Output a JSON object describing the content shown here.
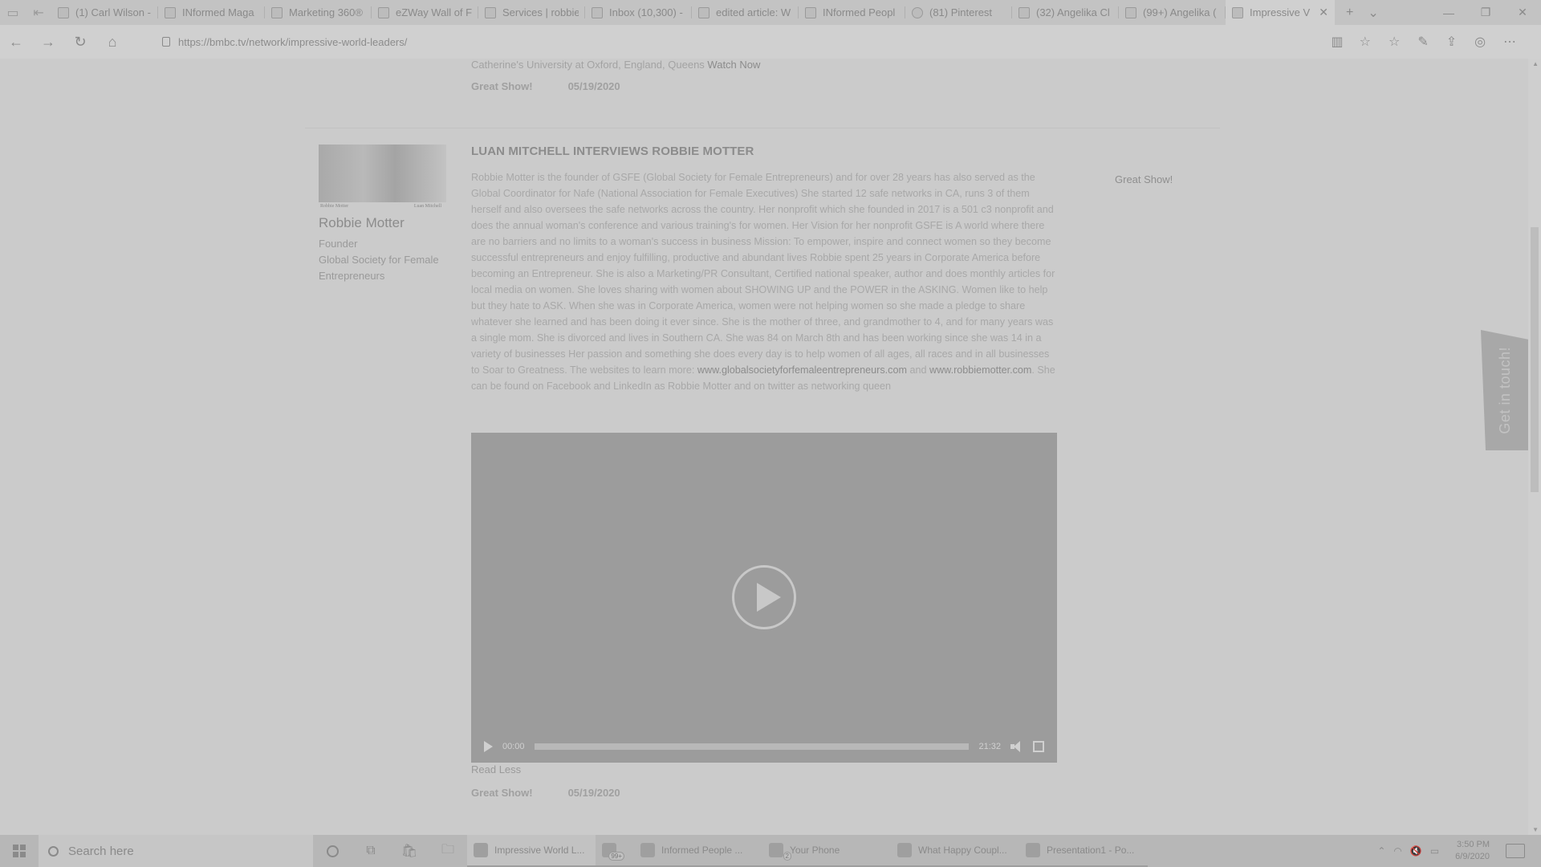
{
  "browser": {
    "tabs": [
      {
        "label": "(1) Carl Wilson -",
        "icon": "facebook-icon"
      },
      {
        "label": "INformed Maga",
        "icon": "page-icon"
      },
      {
        "label": "Marketing 360®",
        "icon": "page-icon"
      },
      {
        "label": "eZWay Wall of F",
        "icon": "page-icon"
      },
      {
        "label": "Services | robbie",
        "icon": "page-icon"
      },
      {
        "label": "Inbox (10,300) -",
        "icon": "mail-icon"
      },
      {
        "label": "edited article: W",
        "icon": "mail-icon"
      },
      {
        "label": "INformed Peopl",
        "icon": "page-icon"
      },
      {
        "label": "(81) Pinterest",
        "icon": "pinterest-icon"
      },
      {
        "label": "(32) Angelika Cl",
        "icon": "page-icon"
      },
      {
        "label": "(99+) Angelika (",
        "icon": "page-icon"
      },
      {
        "label": "Impressive V",
        "icon": "page-icon",
        "active": true
      }
    ],
    "url": "https://bmbc.tv/network/impressive-world-leaders/"
  },
  "prev_entry": {
    "tail_text": "Catherine's University at Oxford, England, Queens",
    "watch_label": "Watch Now",
    "rating": "Great Show!",
    "date": "05/19/2020"
  },
  "entry": {
    "title": "LUAN MITCHELL INTERVIEWS ROBBIE MOTTER",
    "photo_caption_left": "Robbie Motter",
    "photo_caption_right": "Luan Mitchell",
    "person_name": "Robbie Motter",
    "person_role": "Founder",
    "person_org": "Global Society for Female Entrepreneurs",
    "body_text": "Robbie Motter is the founder of GSFE (Global Society for Female Entrepreneurs) and for over 28 years has also served as the Global Coordinator for Nafe (National Association for Female Executives) She started 12 safe networks in CA, runs 3 of them herself and also oversees the safe networks across the country. Her nonprofit which she founded in 2017 is a 501 c3 nonprofit and does the annual woman's conference and various training's for women. Her Vision for her nonprofit GSFE is A world where there are no barriers and no limits to a woman's success in business Mission: To empower, inspire and connect women so they become successful entrepreneurs and enjoy fulfilling, productive and abundant lives Robbie spent 25 years in Corporate America before becoming an Entrepreneur. She is also a Marketing/PR Consultant, Certified national speaker, author and does monthly articles for local media on women. She loves sharing with women about SHOWING UP and the POWER in the ASKING. Women like to help but they hate to ASK. When she was in Corporate America, women were not helping women so she made a pledge to share whatever she learned and has been doing it ever since. She is the mother of three, and grandmother to 4, and for many years was a single mom. She is divorced and lives in Southern CA. She was 84 on March 8th and has been working since she was 14 in a variety of businesses Her passion and something she does every day is to help women of all ages, all races and in all businesses to Soar to Greatness. The websites to learn more:",
    "link_1": "www.globalsocietyforfemaleentrepreneurs.com",
    "and_text": "and",
    "link_2": "www.robbiemotter.com",
    "body_tail": ". She can be found on Facebook and LinkedIn as Robbie Motter and on twitter as networking queen",
    "side_rating": "Great Show!",
    "video": {
      "current_time": "00:00",
      "duration": "21:32",
      "progress": 0
    },
    "read_less": "Read Less",
    "rating": "Great Show!",
    "date": "05/19/2020"
  },
  "get_in_touch": "Get in touch!",
  "taskbar": {
    "search_placeholder": "Search here",
    "apps": [
      {
        "label": "Impressive World L...",
        "active": true
      },
      {
        "label": "",
        "badge": "99+"
      },
      {
        "label": "Informed People ..."
      },
      {
        "label": "Your Phone",
        "badge": "2"
      },
      {
        "label": "What Happy Coupl..."
      },
      {
        "label": "Presentation1 - Po..."
      }
    ],
    "time": "3:50 PM",
    "date": "6/9/2020"
  }
}
